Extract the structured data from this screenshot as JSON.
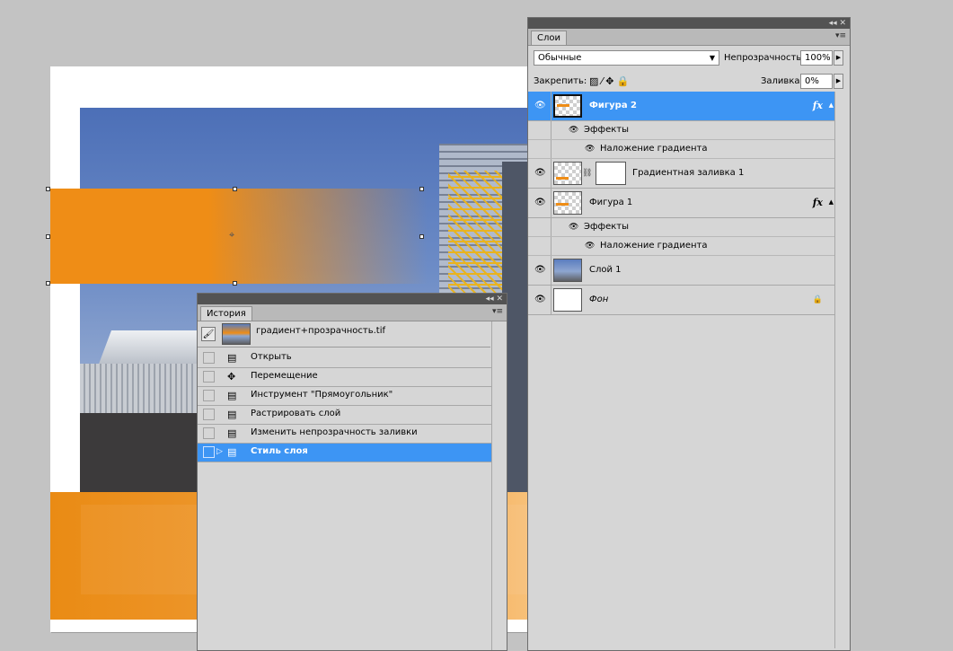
{
  "canvas": {
    "colors": {
      "shape_orange": "#ef8d16",
      "sky_blue": "#4c6fb7"
    }
  },
  "layers_panel": {
    "tab": "Слои",
    "blend_mode": "Обычные",
    "opacity_label": "Непрозрачность:",
    "opacity_value": "100%",
    "lock_label": "Закрепить:",
    "fill_label": "Заливка:",
    "fill_value": "0%",
    "topbar_controls": "◂◂ ✕",
    "menu_icon": "▾≡",
    "layers": [
      {
        "name": "Фигура 2",
        "selected": true,
        "fx": "fx",
        "effects_label": "Эффекты",
        "effect": "Наложение градиента"
      },
      {
        "name": "Градиентная заливка 1"
      },
      {
        "name": "Фигура 1",
        "fx": "fx",
        "effects_label": "Эффекты",
        "effect": "Наложение градиента"
      },
      {
        "name": "Слой 1"
      },
      {
        "name": "Фон"
      }
    ],
    "colors": {
      "selected": "#3d95f4"
    }
  },
  "history_panel": {
    "tab": "История",
    "topbar_controls": "◂◂ ✕",
    "menu_icon": "▾≡",
    "snapshot": "градиент+прозрачность.tif",
    "states": [
      "Открыть",
      "Перемещение",
      "Инструмент \"Прямоугольник\"",
      "Растрировать слой",
      "Изменить непрозрачность заливки",
      "Стиль слоя"
    ],
    "selected_state": "Стиль слоя"
  }
}
